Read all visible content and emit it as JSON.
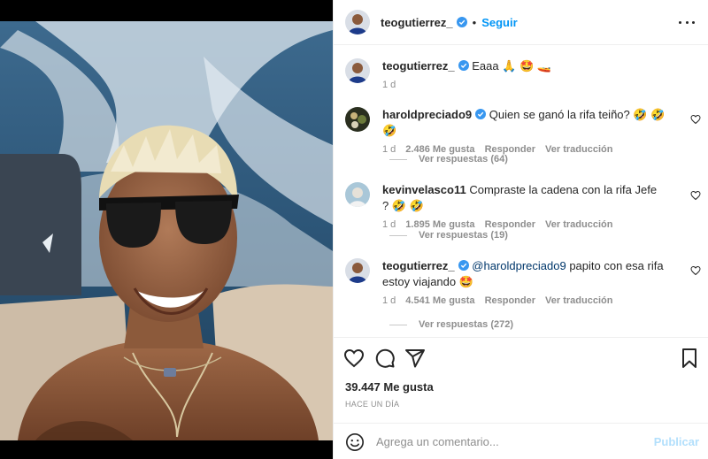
{
  "post": {
    "author": "teogutierrez_",
    "follow_label": "Seguir",
    "separator": "•",
    "caption_user": "teogutierrez_",
    "caption": "Eaaa 🙏 🤩 🚤",
    "caption_age": "1 d"
  },
  "comments": [
    {
      "user": "haroldpreciado9",
      "mention": "",
      "text": "Quien se ganó la rifa teiño? 🤣 🤣 🤣",
      "age": "1 d",
      "likes": "2.486 Me gusta",
      "reply_label": "Responder",
      "translate_label": "Ver traducción",
      "view_replies": "Ver respuestas (64)"
    },
    {
      "user": "kevinvelasco11",
      "mention": "",
      "text": "Compraste la cadena con la rifa Jefe ? 🤣 🤣",
      "age": "1 d",
      "likes": "1.895 Me gusta",
      "reply_label": "Responder",
      "translate_label": "Ver traducción",
      "view_replies": "Ver respuestas (19)"
    },
    {
      "user": "teogutierrez_",
      "mention": "@haroldpreciado9",
      "text": " papito con esa rifa estoy viajando 🤩",
      "age": "1 d",
      "likes": "4.541 Me gusta",
      "reply_label": "Responder",
      "translate_label": "Ver traducción",
      "view_replies": "Ver respuestas (272)"
    }
  ],
  "footer": {
    "likes": "39.447 Me gusta",
    "time_ago": "HACE UN DÍA",
    "comment_placeholder": "Agrega un comentario...",
    "publish_label": "Publicar"
  },
  "icons": {
    "like": "heart-icon",
    "comment": "comment-icon",
    "share": "share-icon",
    "save": "bookmark-icon",
    "emoji": "emoji-icon",
    "verified": "verified-badge-icon",
    "more": "more-options-icon"
  },
  "colors": {
    "accent": "#0095f6",
    "verified": "#3897f0",
    "publish_disabled": "#b2dffc",
    "secondary_text": "#8e8e8e",
    "mention": "#00376b"
  }
}
